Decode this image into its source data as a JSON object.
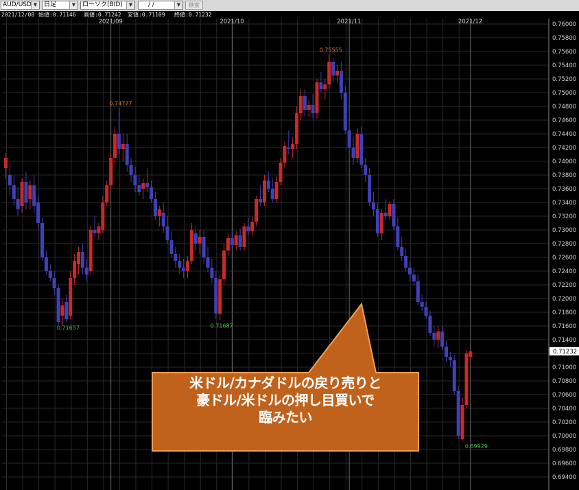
{
  "toolbar": {
    "symbol": "AUD/USD",
    "period": "日足",
    "chart_type": "ローソク(BID)",
    "date": " /  /",
    "search_label": "検索"
  },
  "info": {
    "date": "2021/12/08",
    "open": "始値:0.71146",
    "high": "高値:0.71242",
    "low": "安値:0.71109",
    "close": "終値:0.71232"
  },
  "colors": {
    "up": "#c62a2a",
    "down": "#4040b8",
    "grid": "#2a2a2a",
    "high_label": "#e07a30",
    "low_label": "#3cc03c"
  },
  "chart_data": {
    "type": "candlestick",
    "ylim": [
      0.694,
      0.762
    ],
    "y_ticks": [
      "0.76000",
      "0.75800",
      "0.75600",
      "0.75400",
      "0.75200",
      "0.75000",
      "0.74800",
      "0.74600",
      "0.74400",
      "0.74200",
      "0.74000",
      "0.73800",
      "0.73600",
      "0.73400",
      "0.73200",
      "0.73000",
      "0.72800",
      "0.72600",
      "0.72400",
      "0.72200",
      "0.72000",
      "0.71800",
      "0.71600",
      "0.71400",
      "0.71200",
      "0.71000",
      "0.70800",
      "0.70600",
      "0.70400",
      "0.70200",
      "0.70000",
      "0.69800",
      "0.69600",
      "0.69400"
    ],
    "x_labels": [
      {
        "label": "2021/09",
        "index": 26
      },
      {
        "label": "2021/10",
        "index": 56
      },
      {
        "label": "2021/11",
        "index": 85
      },
      {
        "label": "2021/12",
        "index": 115
      }
    ],
    "current_price": "0.71232",
    "annotations": [
      {
        "text": "0.74777",
        "index": 28,
        "value": 0.74777,
        "kind": "high"
      },
      {
        "text": "0.75555",
        "index": 80,
        "value": 0.75555,
        "kind": "high"
      },
      {
        "text": "0.71657",
        "index": 15,
        "value": 0.71657,
        "kind": "low"
      },
      {
        "text": "0.71687",
        "index": 53,
        "value": 0.71687,
        "kind": "low"
      },
      {
        "text": "0.69929",
        "index": 116,
        "value": 0.69929,
        "kind": "low"
      }
    ],
    "candles": [
      [
        0.739,
        0.7412,
        0.7375,
        0.7405
      ],
      [
        0.738,
        0.7398,
        0.735,
        0.7365
      ],
      [
        0.7365,
        0.7378,
        0.7335,
        0.7345
      ],
      [
        0.7345,
        0.7362,
        0.732,
        0.733
      ],
      [
        0.7335,
        0.7375,
        0.7325,
        0.737
      ],
      [
        0.737,
        0.7385,
        0.733,
        0.734
      ],
      [
        0.7345,
        0.7372,
        0.733,
        0.7365
      ],
      [
        0.7365,
        0.738,
        0.7325,
        0.7335
      ],
      [
        0.734,
        0.735,
        0.73,
        0.731
      ],
      [
        0.731,
        0.7318,
        0.7255,
        0.726
      ],
      [
        0.726,
        0.727,
        0.7235,
        0.724
      ],
      [
        0.724,
        0.725,
        0.7225,
        0.723
      ],
      [
        0.723,
        0.724,
        0.7205,
        0.7215
      ],
      [
        0.7215,
        0.722,
        0.716,
        0.7166
      ],
      [
        0.7175,
        0.72,
        0.716,
        0.719
      ],
      [
        0.7195,
        0.7205,
        0.7165,
        0.717
      ],
      [
        0.7175,
        0.724,
        0.717,
        0.723
      ],
      [
        0.723,
        0.7265,
        0.722,
        0.7255
      ],
      [
        0.725,
        0.7275,
        0.7235,
        0.7268
      ],
      [
        0.7268,
        0.728,
        0.7235,
        0.7245
      ],
      [
        0.7245,
        0.7258,
        0.7225,
        0.7235
      ],
      [
        0.724,
        0.7305,
        0.7235,
        0.73
      ],
      [
        0.73,
        0.732,
        0.729,
        0.7295
      ],
      [
        0.7295,
        0.731,
        0.7285,
        0.7305
      ],
      [
        0.73,
        0.735,
        0.7295,
        0.734
      ],
      [
        0.734,
        0.7372,
        0.7335,
        0.7365
      ],
      [
        0.7365,
        0.741,
        0.7355,
        0.7405
      ],
      [
        0.7405,
        0.745,
        0.7395,
        0.744
      ],
      [
        0.744,
        0.7478,
        0.741,
        0.7418
      ],
      [
        0.7418,
        0.744,
        0.74,
        0.7425
      ],
      [
        0.7425,
        0.744,
        0.7385,
        0.7395
      ],
      [
        0.7395,
        0.7405,
        0.737,
        0.738
      ],
      [
        0.738,
        0.7392,
        0.7355,
        0.7365
      ],
      [
        0.7365,
        0.738,
        0.735,
        0.7355
      ],
      [
        0.736,
        0.7375,
        0.7345,
        0.7368
      ],
      [
        0.7368,
        0.739,
        0.7355,
        0.7362
      ],
      [
        0.7362,
        0.7372,
        0.734,
        0.7345
      ],
      [
        0.7345,
        0.7355,
        0.7315,
        0.732
      ],
      [
        0.732,
        0.7335,
        0.7305,
        0.733
      ],
      [
        0.7325,
        0.734,
        0.7295,
        0.7305
      ],
      [
        0.7305,
        0.732,
        0.728,
        0.7285
      ],
      [
        0.7285,
        0.7298,
        0.726,
        0.7265
      ],
      [
        0.7265,
        0.7275,
        0.7245,
        0.7255
      ],
      [
        0.7255,
        0.7265,
        0.7235,
        0.7245
      ],
      [
        0.7245,
        0.7258,
        0.723,
        0.724
      ],
      [
        0.724,
        0.7262,
        0.723,
        0.7255
      ],
      [
        0.7255,
        0.731,
        0.725,
        0.73
      ],
      [
        0.7295,
        0.7305,
        0.727,
        0.728
      ],
      [
        0.728,
        0.73,
        0.7265,
        0.729
      ],
      [
        0.729,
        0.73,
        0.725,
        0.726
      ],
      [
        0.726,
        0.7275,
        0.7238,
        0.7245
      ],
      [
        0.7245,
        0.7258,
        0.7222,
        0.723
      ],
      [
        0.723,
        0.724,
        0.717,
        0.7178
      ],
      [
        0.7178,
        0.7235,
        0.7168,
        0.7228
      ],
      [
        0.7228,
        0.728,
        0.722,
        0.727
      ],
      [
        0.727,
        0.7295,
        0.7262,
        0.7288
      ],
      [
        0.7288,
        0.73,
        0.727,
        0.7278
      ],
      [
        0.7278,
        0.7298,
        0.727,
        0.7292
      ],
      [
        0.7292,
        0.7302,
        0.727,
        0.7275
      ],
      [
        0.7275,
        0.731,
        0.727,
        0.7305
      ],
      [
        0.7305,
        0.7318,
        0.7292,
        0.7298
      ],
      [
        0.7298,
        0.732,
        0.7292,
        0.7312
      ],
      [
        0.7312,
        0.735,
        0.7305,
        0.7345
      ],
      [
        0.7345,
        0.7365,
        0.7335,
        0.734
      ],
      [
        0.734,
        0.738,
        0.7335,
        0.7372
      ],
      [
        0.7372,
        0.7385,
        0.7355,
        0.736
      ],
      [
        0.736,
        0.7375,
        0.734,
        0.7345
      ],
      [
        0.7345,
        0.7378,
        0.734,
        0.737
      ],
      [
        0.737,
        0.7405,
        0.7365,
        0.7398
      ],
      [
        0.7398,
        0.7428,
        0.739,
        0.7422
      ],
      [
        0.742,
        0.7445,
        0.741,
        0.7418
      ],
      [
        0.7418,
        0.7435,
        0.7405,
        0.7425
      ],
      [
        0.7425,
        0.748,
        0.7418,
        0.747
      ],
      [
        0.747,
        0.7505,
        0.746,
        0.7495
      ],
      [
        0.7495,
        0.7505,
        0.7465,
        0.7475
      ],
      [
        0.7475,
        0.749,
        0.7465,
        0.7482
      ],
      [
        0.7482,
        0.7498,
        0.7462,
        0.747
      ],
      [
        0.747,
        0.752,
        0.7462,
        0.7515
      ],
      [
        0.7515,
        0.753,
        0.75,
        0.7505
      ],
      [
        0.7505,
        0.752,
        0.749,
        0.7512
      ],
      [
        0.7512,
        0.7556,
        0.7505,
        0.7545
      ],
      [
        0.7545,
        0.755,
        0.7515,
        0.7525
      ],
      [
        0.7525,
        0.754,
        0.7515,
        0.7532
      ],
      [
        0.7532,
        0.7545,
        0.749,
        0.75
      ],
      [
        0.75,
        0.751,
        0.744,
        0.7445
      ],
      [
        0.7445,
        0.746,
        0.7415,
        0.742
      ],
      [
        0.742,
        0.7435,
        0.7395,
        0.7405
      ],
      [
        0.7405,
        0.7448,
        0.7398,
        0.744
      ],
      [
        0.744,
        0.745,
        0.739,
        0.7395
      ],
      [
        0.7395,
        0.7405,
        0.737,
        0.738
      ],
      [
        0.738,
        0.739,
        0.7335,
        0.734
      ],
      [
        0.734,
        0.7355,
        0.732,
        0.733
      ],
      [
        0.733,
        0.734,
        0.729,
        0.7295
      ],
      [
        0.7295,
        0.733,
        0.7285,
        0.7325
      ],
      [
        0.7325,
        0.7345,
        0.7315,
        0.732
      ],
      [
        0.732,
        0.7342,
        0.7315,
        0.7338
      ],
      [
        0.7338,
        0.7345,
        0.73,
        0.7305
      ],
      [
        0.7305,
        0.7318,
        0.727,
        0.7275
      ],
      [
        0.7275,
        0.729,
        0.7255,
        0.7262
      ],
      [
        0.7262,
        0.7272,
        0.724,
        0.7245
      ],
      [
        0.7245,
        0.7255,
        0.7225,
        0.7235
      ],
      [
        0.7235,
        0.7245,
        0.7218,
        0.7225
      ],
      [
        0.7225,
        0.7235,
        0.719,
        0.7195
      ],
      [
        0.7195,
        0.7205,
        0.7182,
        0.7188
      ],
      [
        0.7188,
        0.7196,
        0.717,
        0.7175
      ],
      [
        0.7175,
        0.7182,
        0.7145,
        0.715
      ],
      [
        0.715,
        0.716,
        0.713,
        0.714
      ],
      [
        0.714,
        0.716,
        0.7128,
        0.7152
      ],
      [
        0.7152,
        0.716,
        0.7125,
        0.713
      ],
      [
        0.713,
        0.7138,
        0.7108,
        0.7115
      ],
      [
        0.7115,
        0.7122,
        0.71,
        0.711
      ],
      [
        0.711,
        0.7118,
        0.706,
        0.7065
      ],
      [
        0.7065,
        0.7072,
        0.6995,
        0.7
      ],
      [
        0.6995,
        0.7055,
        0.6993,
        0.7045
      ],
      [
        0.7045,
        0.7125,
        0.704,
        0.712
      ],
      [
        0.7115,
        0.7124,
        0.7111,
        0.7123
      ]
    ]
  },
  "callout": {
    "lines": [
      "米ドル/カナダドルの戻り売りと",
      "豪ドル/米ドルの押し目買いで",
      "臨みたい"
    ]
  }
}
